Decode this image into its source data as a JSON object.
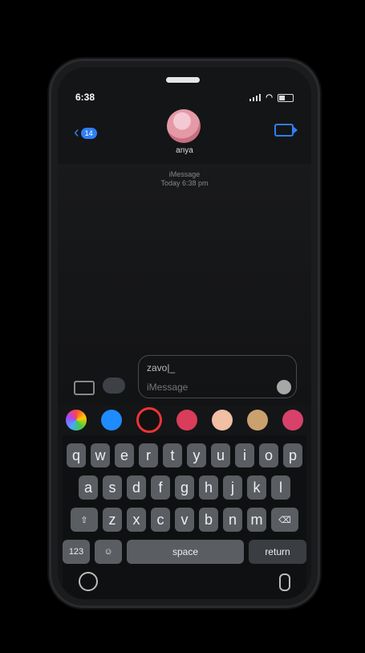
{
  "status_bar": {
    "time": "6:38"
  },
  "navigation": {
    "back_count": "14"
  },
  "contact": {
    "name": "anya"
  },
  "conversation": {
    "service": "iMessage",
    "timestamp": "Today 6:38 pm"
  },
  "composer": {
    "typed_text": "zavo|_",
    "placeholder": "iMessage"
  },
  "keyboard": {
    "row1": [
      "q",
      "w",
      "e",
      "r",
      "t",
      "y",
      "u",
      "i",
      "o",
      "p"
    ],
    "row2": [
      "a",
      "s",
      "d",
      "f",
      "g",
      "h",
      "j",
      "k",
      "l"
    ],
    "row3": [
      "z",
      "x",
      "c",
      "v",
      "b",
      "n",
      "m"
    ],
    "numbers_key": "123",
    "space_key": "space",
    "return_key": "return"
  }
}
